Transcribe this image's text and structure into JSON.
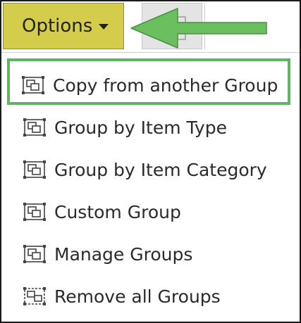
{
  "toolbar": {
    "options_label": "Options",
    "options_icon": "caret-down-icon"
  },
  "annotation": {
    "arrow_color": "#6bbf5f",
    "highlight_color": "#5fb564"
  },
  "menu": {
    "items": [
      {
        "label": "Copy from another Group",
        "icon": "group-icon",
        "highlighted": true
      },
      {
        "label": "Group by Item Type",
        "icon": "group-icon"
      },
      {
        "label": "Group by Item Category",
        "icon": "group-icon"
      },
      {
        "label": "Custom Group",
        "icon": "group-icon"
      },
      {
        "label": "Manage Groups",
        "icon": "group-icon"
      },
      {
        "label": "Remove all Groups",
        "icon": "ungroup-icon"
      }
    ]
  }
}
